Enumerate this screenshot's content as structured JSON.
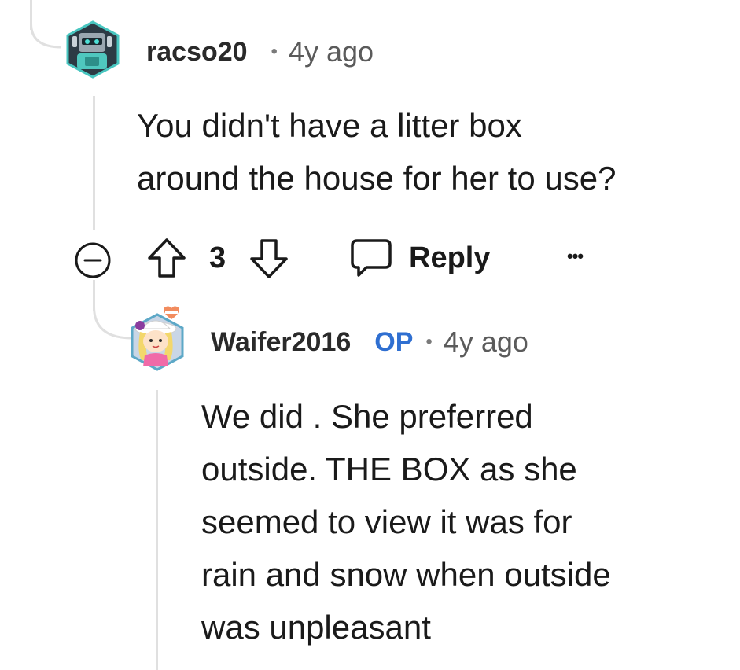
{
  "comment1": {
    "username": "racso20",
    "separator": "•",
    "age": "4y ago",
    "body": "You didn't have a litter box\naround the house for her to use?",
    "avatar_icon": "robot-avatar-icon"
  },
  "actions": {
    "vote_count": "3",
    "reply_label": "Reply",
    "more_label": "•••",
    "collapse_icon": "collapse-minus-icon",
    "upvote_icon": "upvote-arrow-icon",
    "downvote_icon": "downvote-arrow-icon",
    "reply_icon": "speech-bubble-icon"
  },
  "comment2": {
    "username": "Waifer2016",
    "op_badge": "OP",
    "separator": "•",
    "age": "4y ago",
    "body": "We did . She preferred\noutside. THE BOX as she\nseemed to view it was for\nrain and snow when outside\nwas unpleasant",
    "avatar_icon": "girl-with-hat-avatar-icon"
  },
  "colors": {
    "op_blue": "#2f6fd1",
    "thread_line": "#e0e0e0",
    "text": "#1a1a1a",
    "meta": "#5b5b5b"
  }
}
